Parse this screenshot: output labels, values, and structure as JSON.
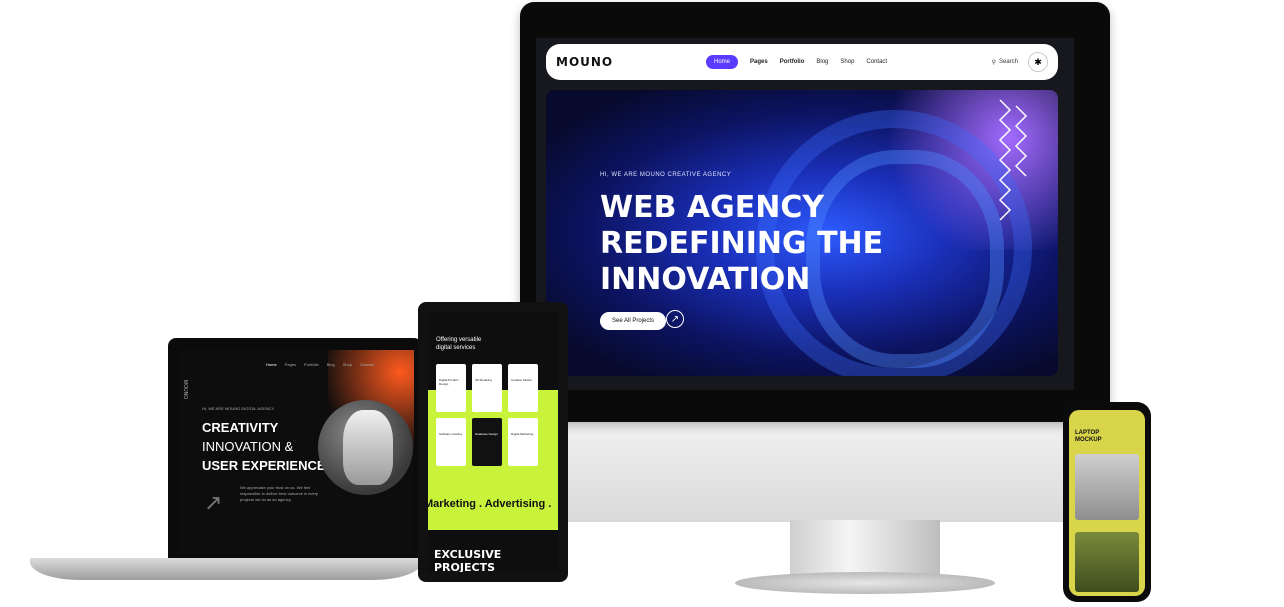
{
  "desktop": {
    "logo": "MOUNO",
    "nav": {
      "items": [
        "Home",
        "Pages",
        "Portfolio",
        "Blog",
        "Shop",
        "Contact"
      ],
      "active": "Home",
      "search_label": "Search"
    },
    "hero": {
      "tagline": "HI, WE ARE MOUNO CREATIVE AGENCY",
      "headline_lines": [
        "WEB AGENCY",
        "REDEFINING THE",
        "INNOVATION"
      ],
      "cta_label": "See All Projects"
    },
    "colors": {
      "accent": "#5a3cff",
      "hero_blue": "#2d5bff"
    }
  },
  "laptop": {
    "logo": "MOUNO",
    "nav_items": [
      "Home",
      "Pages",
      "Portfolio",
      "Blog",
      "Shop",
      "Contact"
    ],
    "tagline": "HI, WE ARE MOUNO DIGITAL AGENCY",
    "headline_lines": [
      "CREATIVITY",
      "INNOVATION &",
      "USER EXPERIENCE"
    ],
    "body": "We appreciate your trust on us. We feel responsible to deliver best outcome in every projects we do as an agency."
  },
  "tablet": {
    "title_lines": [
      "Offering versatile",
      "digital services"
    ],
    "cards": [
      "Digital Product Design",
      "3D Modeling",
      "Creative Motion",
      "Software Hosting",
      "Database Design",
      "Digital Marketing"
    ],
    "marquee": "Marketing . Advertising .",
    "footer_title": "EXCLUSIVE PROJECTS",
    "colors": {
      "lime": "#c9f23b"
    }
  },
  "phone": {
    "title_lines": [
      "LAPTOP",
      "MOCKUP"
    ],
    "colors": {
      "background": "#d9d54b"
    }
  }
}
